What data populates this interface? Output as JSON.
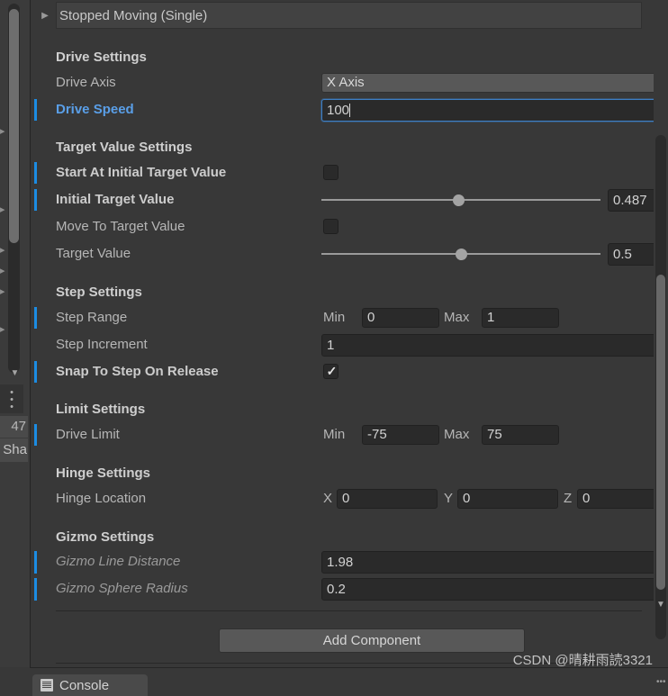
{
  "window": {
    "background": "#383838",
    "accent_blue": "#1c8ce3",
    "focus_blue": "#5a9fe8"
  },
  "left_panel": {
    "row_number": "47",
    "row_text": "Sha",
    "kebab_icon": "vertical-dots-icon",
    "foldout_icon": "chevron-right-icon",
    "scroll_down_icon": "chevron-down-icon"
  },
  "inspector": {
    "event_row": {
      "label": "Stopped Moving (Single)",
      "foldout_icon": "triangle-right-icon"
    },
    "sections": [
      {
        "title": "Drive Settings",
        "rows": [
          {
            "label": "Drive Axis",
            "style": "normal",
            "control": "dropdown",
            "value": "X Axis",
            "modified": false
          },
          {
            "label": "Drive Speed",
            "style": "focused",
            "control": "text",
            "value": "100",
            "modified": true
          }
        ]
      },
      {
        "title": "Target Value Settings",
        "rows": [
          {
            "label": "Start At Initial Target Value",
            "style": "bold",
            "control": "checkbox",
            "checked": false,
            "modified": true
          },
          {
            "label": "Initial Target Value",
            "style": "bold",
            "control": "slider",
            "value": "0.487",
            "slider_fraction": 0.38,
            "modified": true
          },
          {
            "label": "Move To Target Value",
            "style": "normal",
            "control": "checkbox",
            "checked": false,
            "modified": false
          },
          {
            "label": "Target Value",
            "style": "normal",
            "control": "slider",
            "value": "0.5",
            "slider_fraction": 0.4,
            "modified": false
          }
        ]
      },
      {
        "title": "Step Settings",
        "rows": [
          {
            "label": "Step Range",
            "style": "normal",
            "control": "minmax",
            "min_prefix": "Min",
            "min_value": "0",
            "max_prefix": "Max",
            "max_value": "1",
            "modified": true
          },
          {
            "label": "Step Increment",
            "style": "normal",
            "control": "text",
            "value": "1",
            "modified": false
          },
          {
            "label": "Snap To Step On Release",
            "style": "bold",
            "control": "checkbox",
            "checked": true,
            "check_icon": "checkmark-icon",
            "modified": true
          }
        ]
      },
      {
        "title": "Limit Settings",
        "rows": [
          {
            "label": "Drive Limit",
            "style": "normal",
            "control": "minmax",
            "min_prefix": "Min",
            "min_value": "-75",
            "max_prefix": "Max",
            "max_value": "75",
            "modified": true
          }
        ]
      },
      {
        "title": "Hinge Settings",
        "rows": [
          {
            "label": "Hinge Location",
            "style": "normal",
            "control": "vector3",
            "x_prefix": "X",
            "x_value": "0",
            "y_prefix": "Y",
            "y_value": "0",
            "z_prefix": "Z",
            "z_value": "0",
            "modified": false
          }
        ]
      },
      {
        "title": "Gizmo Settings",
        "rows": [
          {
            "label": "Gizmo Line Distance",
            "style": "italic",
            "control": "text",
            "value": "1.98",
            "modified": true
          },
          {
            "label": "Gizmo Sphere Radius",
            "style": "italic",
            "control": "text",
            "value": "0.2",
            "modified": true
          }
        ]
      }
    ],
    "add_component_label": "Add Component"
  },
  "right_scrollbar": {
    "down_arrow_icon": "chevron-down-icon",
    "kebab_icon": "vertical-dots-icon"
  },
  "bottom": {
    "console_tab_label": "Console",
    "console_tab_icon": "console-list-icon"
  },
  "watermark": "CSDN @晴耕雨読3321"
}
